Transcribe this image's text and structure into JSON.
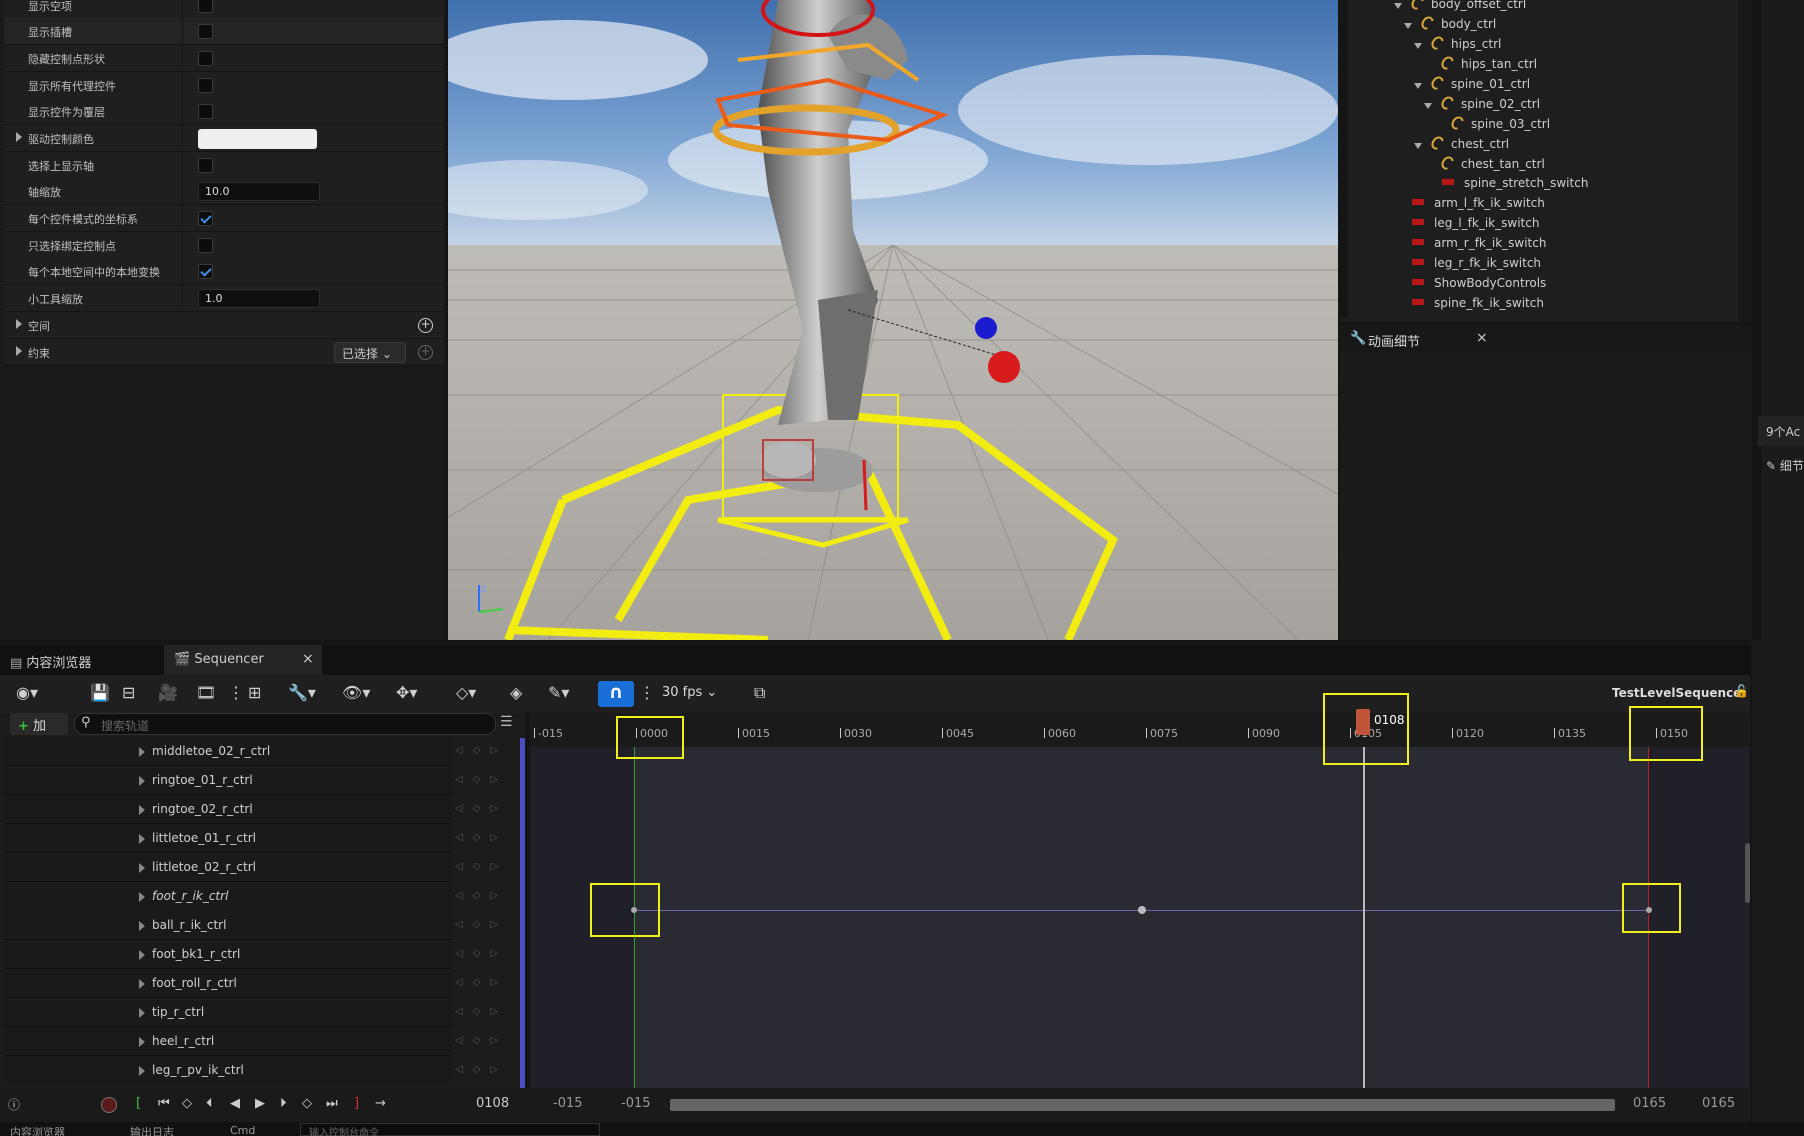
{
  "details": {
    "rows": [
      {
        "label": "显示空项",
        "type": "check",
        "checked": false
      },
      {
        "label": "显示插槽",
        "type": "check",
        "checked": false
      },
      {
        "label": "隐藏控制点形状",
        "type": "check",
        "checked": false
      },
      {
        "label": "显示所有代理控件",
        "type": "check",
        "checked": false
      },
      {
        "label": "显示控件为覆层",
        "type": "check",
        "checked": false
      },
      {
        "label": "驱动控制颜色",
        "type": "color"
      },
      {
        "label": "选择上显示轴",
        "type": "check",
        "checked": false
      },
      {
        "label": "轴缩放",
        "type": "input",
        "value": "10.0"
      },
      {
        "label": "每个控件模式的坐标系",
        "type": "check",
        "checked": true
      },
      {
        "label": "只选择绑定控制点",
        "type": "check",
        "checked": false
      },
      {
        "label": "每个本地空间中的本地变换",
        "type": "check",
        "checked": true
      },
      {
        "label": "小工具缩放",
        "type": "input",
        "value": "1.0"
      }
    ],
    "space_label": "空间",
    "constraint_label": "约束",
    "selected_btn": "已选择"
  },
  "outliner": {
    "items": [
      {
        "label": "body_offset_ctrl",
        "icon": "ctrl"
      },
      {
        "label": "body_ctrl",
        "icon": "ctrl"
      },
      {
        "label": "hips_ctrl",
        "icon": "ctrl"
      },
      {
        "label": "hips_tan_ctrl",
        "icon": "ctrl"
      },
      {
        "label": "spine_01_ctrl",
        "icon": "ctrl"
      },
      {
        "label": "spine_02_ctrl",
        "icon": "ctrl"
      },
      {
        "label": "spine_03_ctrl",
        "icon": "ctrl"
      },
      {
        "label": "chest_ctrl",
        "icon": "ctrl"
      },
      {
        "label": "chest_tan_ctrl",
        "icon": "ctrl"
      },
      {
        "label": "spine_stretch_switch",
        "icon": "switch"
      },
      {
        "label": "arm_l_fk_ik_switch",
        "icon": "switch"
      },
      {
        "label": "leg_l_fk_ik_switch",
        "icon": "switch"
      },
      {
        "label": "arm_r_fk_ik_switch",
        "icon": "switch"
      },
      {
        "label": "leg_r_fk_ik_switch",
        "icon": "switch"
      },
      {
        "label": "ShowBodyControls",
        "icon": "switch"
      },
      {
        "label": "spine_fk_ik_switch",
        "icon": "switch"
      }
    ]
  },
  "anim_details": {
    "title": "动画细节",
    "close": "×"
  },
  "right_stub": {
    "actors": "9个Ac",
    "details": "细节"
  },
  "tabs": {
    "content_browser": "内容浏览器",
    "sequencer": "Sequencer",
    "close": "×"
  },
  "toolbar": {
    "add": "加",
    "search_placeholder": "搜索轨道",
    "fps": "30 fps",
    "sequence_name": "TestLevelSequence"
  },
  "tracks": [
    "middletoe_02_r_ctrl",
    "ringtoe_01_r_ctrl",
    "ringtoe_02_r_ctrl",
    "littletoe_01_r_ctrl",
    "littletoe_02_r_ctrl",
    "foot_r_ik_ctrl",
    "ball_r_ik_ctrl",
    "foot_bk1_r_ctrl",
    "foot_roll_r_ctrl",
    "tip_r_ctrl",
    "heel_r_ctrl",
    "leg_r_pv_ik_ctrl"
  ],
  "ruler": {
    "ticks": [
      "-015",
      "0000",
      "0015",
      "0030",
      "0045",
      "0060",
      "0075",
      "0090",
      "0105",
      "0120",
      "0135",
      "0150"
    ],
    "current_frame": "0108"
  },
  "bottom": {
    "current_frame": "0108",
    "range_start_a": "-015",
    "range_start_b": "-015",
    "range_end_a": "0165",
    "range_end_b": "0165"
  },
  "status_bar": {
    "item1": "内容浏览器",
    "item2": "输出日志",
    "item3": "Cmd",
    "placeholder": "输入控制台命令"
  },
  "colors": {
    "accent": "#1a6fd6",
    "highlight": "#f2f01a",
    "playhead": "#c0553a"
  }
}
